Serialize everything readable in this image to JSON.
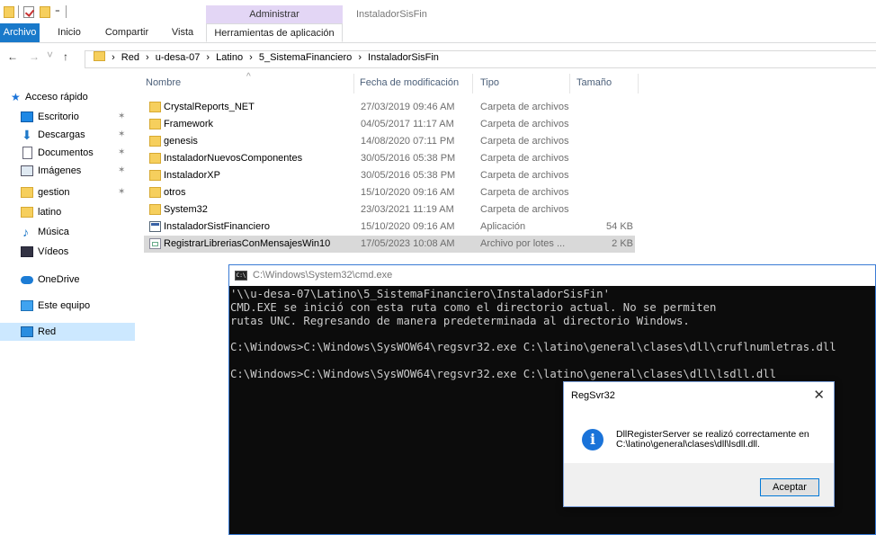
{
  "titlebar": {
    "context_tab": "Administrar",
    "window_title": "InstaladorSisFin"
  },
  "ribbon": {
    "tabs": [
      "Archivo",
      "Inicio",
      "Compartir",
      "Vista",
      "Herramientas de aplicación"
    ]
  },
  "addressbar": {
    "back_icon": "←",
    "forward_icon": "→",
    "dropdown_icon": "˅",
    "up_icon": "↑",
    "separator": "›",
    "crumbs": [
      "Red",
      "u-desa-07",
      "Latino",
      "5_SistemaFinanciero",
      "InstaladorSisFin"
    ]
  },
  "navpane": {
    "pin": "✶",
    "quick_access": "Acceso rápido",
    "items": [
      {
        "label": "Escritorio",
        "pinned": true,
        "icon": "desktop-icon"
      },
      {
        "label": "Descargas",
        "pinned": true,
        "icon": "download-icon"
      },
      {
        "label": "Documentos",
        "pinned": true,
        "icon": "documents-icon"
      },
      {
        "label": "Imágenes",
        "pinned": true,
        "icon": "pictures-icon"
      },
      {
        "label": "gestion",
        "pinned": true,
        "icon": "folder-icon"
      },
      {
        "label": "latino",
        "pinned": false,
        "icon": "folder-icon"
      },
      {
        "label": "Música",
        "pinned": false,
        "icon": "music-icon"
      },
      {
        "label": "Vídeos",
        "pinned": false,
        "icon": "videos-icon"
      }
    ],
    "onedrive": "OneDrive",
    "este_equipo": "Este equipo",
    "red": "Red"
  },
  "filelist": {
    "sort_arrow": "^",
    "columns": {
      "name": "Nombre",
      "date": "Fecha de modificación",
      "type": "Tipo",
      "size": "Tamaño"
    },
    "rows": [
      {
        "name": "CrystalReports_NET",
        "date": "27/03/2019 09:46 AM",
        "type": "Carpeta de archivos",
        "size": "",
        "icon": "folder-icon"
      },
      {
        "name": "Framework",
        "date": "04/05/2017 11:17 AM",
        "type": "Carpeta de archivos",
        "size": "",
        "icon": "folder-icon"
      },
      {
        "name": "genesis",
        "date": "14/08/2020 07:11 PM",
        "type": "Carpeta de archivos",
        "size": "",
        "icon": "folder-icon"
      },
      {
        "name": "InstaladorNuevosComponentes",
        "date": "30/05/2016 05:38 PM",
        "type": "Carpeta de archivos",
        "size": "",
        "icon": "folder-icon"
      },
      {
        "name": "InstaladorXP",
        "date": "30/05/2016 05:38 PM",
        "type": "Carpeta de archivos",
        "size": "",
        "icon": "folder-icon"
      },
      {
        "name": "otros",
        "date": "15/10/2020 09:16 AM",
        "type": "Carpeta de archivos",
        "size": "",
        "icon": "folder-icon"
      },
      {
        "name": "System32",
        "date": "23/03/2021 11:19 AM",
        "type": "Carpeta de archivos",
        "size": "",
        "icon": "folder-icon"
      },
      {
        "name": "InstaladorSistFinanciero",
        "date": "15/10/2020 09:16 AM",
        "type": "Aplicación",
        "size": "54 KB",
        "icon": "application-icon"
      },
      {
        "name": "RegistrarLibreriasConMensajesWin10",
        "date": "17/05/2023 10:08 AM",
        "type": "Archivo por lotes ...",
        "size": "2 KB",
        "icon": "batch-file-icon",
        "selected": true
      }
    ]
  },
  "cmd": {
    "icon_label": "C:\\",
    "title": "C:\\Windows\\System32\\cmd.exe",
    "lines": [
      "'\\\\u-desa-07\\Latino\\5_SistemaFinanciero\\InstaladorSisFin'",
      "CMD.EXE se inició con esta ruta como el directorio actual. No se permiten",
      "rutas UNC. Regresando de manera predeterminada al directorio Windows.",
      "",
      "C:\\Windows>C:\\Windows\\SysWOW64\\regsvr32.exe C:\\latino\\general\\clases\\dll\\cruflnumletras.dll",
      "",
      "C:\\Windows>C:\\Windows\\SysWOW64\\regsvr32.exe C:\\latino\\general\\clases\\dll\\lsdll.dll"
    ]
  },
  "msgbox": {
    "title": "RegSvr32",
    "close": "✕",
    "icon": "i",
    "message_line1": "DllRegisterServer se realizó correctamente en",
    "message_line2": "C:\\latino\\general\\clases\\dll\\lsdll.dll.",
    "ok_label": "Aceptar"
  }
}
